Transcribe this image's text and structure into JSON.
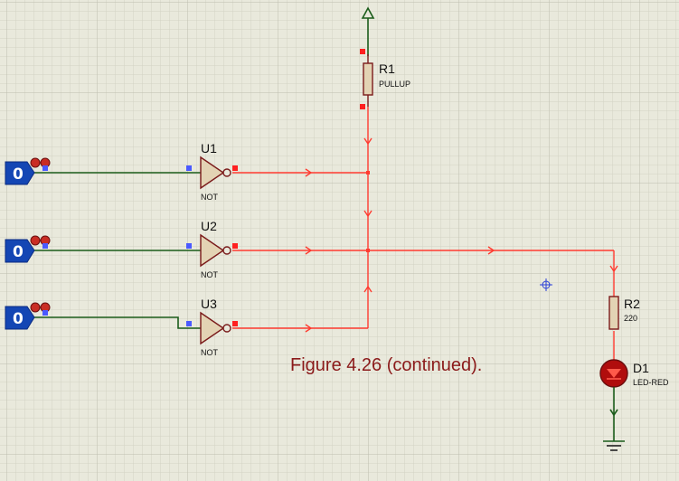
{
  "caption": "Figure 4.26 (continued).",
  "inputs": [
    {
      "state": "0"
    },
    {
      "state": "0"
    },
    {
      "state": "0"
    }
  ],
  "gates": [
    {
      "ref": "U1",
      "type": "NOT"
    },
    {
      "ref": "U2",
      "type": "NOT"
    },
    {
      "ref": "U3",
      "type": "NOT"
    }
  ],
  "resistors": [
    {
      "ref": "R1",
      "value": "PULLUP"
    },
    {
      "ref": "R2",
      "value": "220"
    }
  ],
  "led": {
    "ref": "D1",
    "value": "LED-RED"
  },
  "colors": {
    "background": "#e9e9dc",
    "grid_minor": "#d3d3c4",
    "grid_major": "#bdbdae",
    "wire_low": "#1a5c1a",
    "wire_high": "#ff3b30",
    "component": "#7a1a1a",
    "component_fill": "#e3d3b4",
    "input_fill": "#1446b4"
  }
}
